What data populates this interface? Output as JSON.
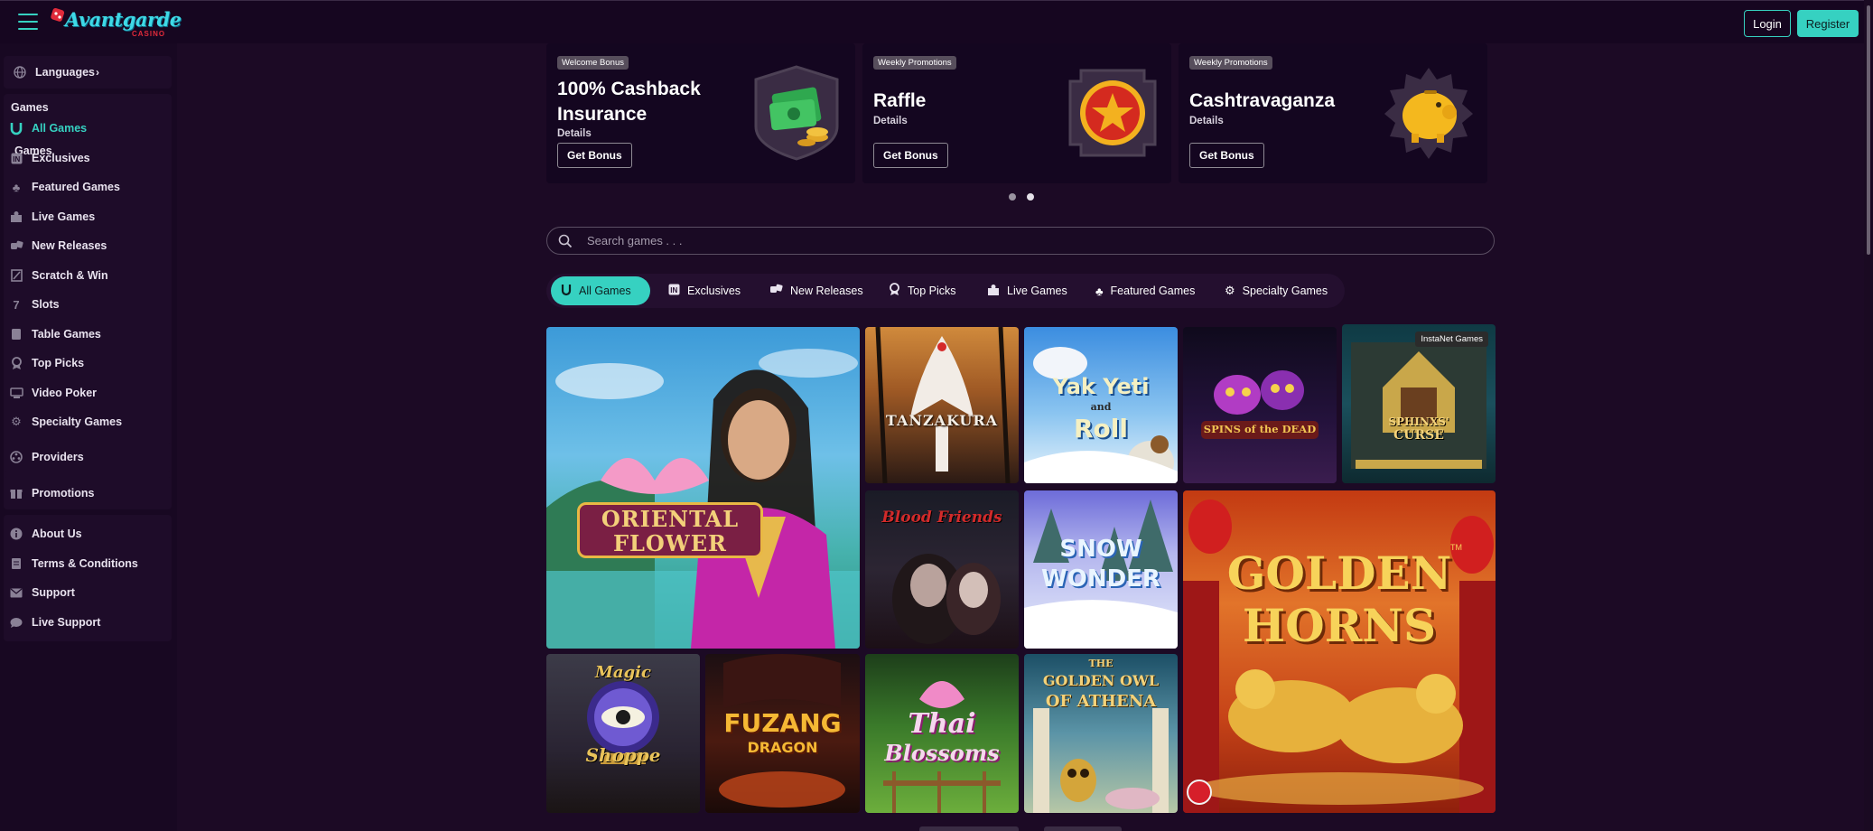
{
  "header": {
    "logo_text": "Avantgarde",
    "logo_sub": "CASINO",
    "login_label": "Login",
    "register_label": "Register",
    "accent": "#36d1c1"
  },
  "sidebar": {
    "languages_label": "Languages",
    "languages_caret": "›",
    "games_header": "Games",
    "games_items": [
      {
        "label": "All Games",
        "icon": "horseshoe-icon",
        "active": true
      },
      {
        "label": "Exclusives",
        "icon": "in-badge-icon"
      },
      {
        "label": "Featured Games",
        "icon": "clover-icon"
      },
      {
        "label": "Live Games",
        "icon": "dealer-icon"
      },
      {
        "label": "New Releases",
        "icon": "dice-icon"
      },
      {
        "label": "Scratch & Win",
        "icon": "scratch-card-icon"
      },
      {
        "label": "Slots",
        "icon": "seven-icon"
      },
      {
        "label": "Table Games",
        "icon": "card-icon"
      },
      {
        "label": "Top Picks",
        "icon": "award-icon"
      },
      {
        "label": "Video Poker",
        "icon": "poker-machine-icon"
      },
      {
        "label": "Specialty Games",
        "icon": "gear-icon"
      }
    ],
    "providers_label": "Providers",
    "promotions_label": "Promotions",
    "info_items": [
      {
        "label": "About Us",
        "icon": "info-icon"
      },
      {
        "label": "Terms & Conditions",
        "icon": "document-icon"
      },
      {
        "label": "Support",
        "icon": "envelope-icon"
      },
      {
        "label": "Live Support",
        "icon": "chat-icon"
      }
    ]
  },
  "promos": [
    {
      "tag": "Welcome Bonus",
      "title_line1": "100% Cashback",
      "title_line2": "Insurance",
      "details": "Details",
      "button": "Get Bonus",
      "art": "cash-stack-icon"
    },
    {
      "tag": "Weekly Promotions",
      "title_line1": "Raffle",
      "title_line2": "",
      "details": "Details",
      "button": "Get Bonus",
      "art": "star-medal-icon"
    },
    {
      "tag": "Weekly Promotions",
      "title_line1": "Cashtravaganza",
      "title_line2": "",
      "details": "Details",
      "button": "Get Bonus",
      "art": "piggy-bank-icon"
    }
  ],
  "search": {
    "placeholder": "Search games . . ."
  },
  "filters": [
    {
      "label": "All Games",
      "active": true
    },
    {
      "label": "Exclusives"
    },
    {
      "label": "New Releases"
    },
    {
      "label": "Top Picks"
    },
    {
      "label": "Live Games"
    },
    {
      "label": "Featured Games"
    },
    {
      "label": "Specialty Games"
    }
  ],
  "games": {
    "oriental_flower": {
      "line1": "ORIENTAL",
      "line2": "FLOWER"
    },
    "tanzakura": "TANZAKURA",
    "yak_yeti_roll": {
      "line1": "Yak Yeti",
      "line2": "Roll",
      "and": "and"
    },
    "spins_of_the_dead": "SPINS of the DEAD",
    "sphinxs_curse": {
      "line1": "SPHINXS'",
      "line2": "CURSE",
      "badge": "InstaNet Games"
    },
    "blood_friends": "Blood Friends",
    "snow_wonder": {
      "line1": "SNOW",
      "line2": "WONDER"
    },
    "golden_horns": {
      "line1": "GOLDEN",
      "line2": "HORNS",
      "tm": "TM"
    },
    "magic_shoppe": {
      "line1": "Magic",
      "line2": "Shoppe"
    },
    "fuzang_dragon": {
      "line1": "FUZANG",
      "line2": "DRAGON"
    },
    "thai_blossoms": {
      "line1": "Thai",
      "line2": "Blossoms"
    },
    "golden_owl": {
      "line1": "THE",
      "line2": "GOLDEN OWL",
      "line3": "OF ATHENA"
    }
  }
}
